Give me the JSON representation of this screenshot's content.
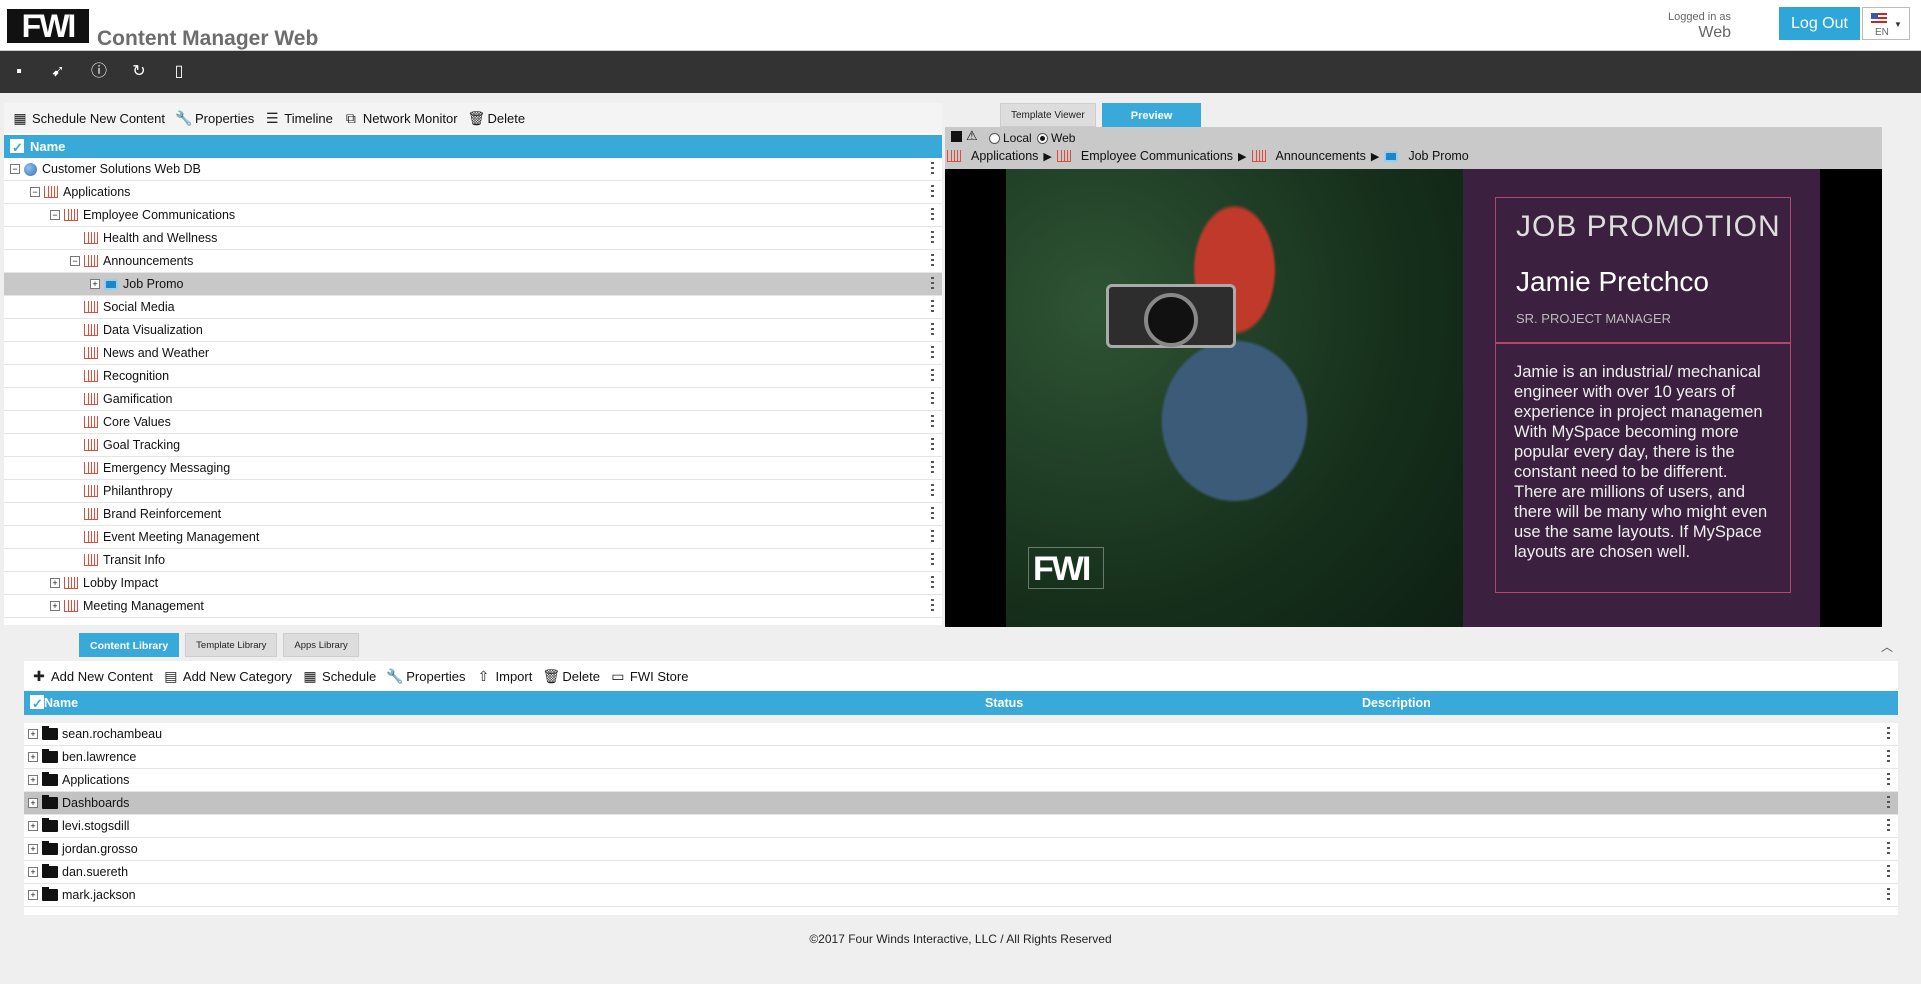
{
  "header": {
    "logo": "FWI",
    "title": "Content Manager Web",
    "logged_in_label": "Logged in as",
    "user": "Web",
    "logout_label": "Log Out",
    "language": "EN"
  },
  "toolbar_icons": [
    "save-icon",
    "rocket-icon",
    "info-icon",
    "refresh-icon",
    "device-icon"
  ],
  "tree_actions": [
    {
      "label": "Schedule New Content",
      "icon": "calendar-icon"
    },
    {
      "label": "Properties",
      "icon": "wrench-icon"
    },
    {
      "label": "Timeline",
      "icon": "timeline-icon"
    },
    {
      "label": "Network Monitor",
      "icon": "monitor-icon"
    },
    {
      "label": "Delete",
      "icon": "trash-icon"
    }
  ],
  "tree": {
    "header": "Name",
    "rows": [
      {
        "label": "Customer Solutions Web DB",
        "indent": 0,
        "expander": "−",
        "icon": "globe"
      },
      {
        "label": "Applications",
        "indent": 1,
        "expander": "−",
        "icon": "category"
      },
      {
        "label": "Employee Communications",
        "indent": 2,
        "expander": "−",
        "icon": "category"
      },
      {
        "label": "Health and Wellness",
        "indent": 3,
        "expander": "",
        "icon": "category"
      },
      {
        "label": "Announcements",
        "indent": 3,
        "expander": "−",
        "icon": "category"
      },
      {
        "label": "Job Promo",
        "indent": 4,
        "expander": "+",
        "icon": "screen",
        "selected": true
      },
      {
        "label": "Social Media",
        "indent": 3,
        "expander": "",
        "icon": "category"
      },
      {
        "label": "Data Visualization",
        "indent": 3,
        "expander": "",
        "icon": "category"
      },
      {
        "label": "News and Weather",
        "indent": 3,
        "expander": "",
        "icon": "category"
      },
      {
        "label": "Recognition",
        "indent": 3,
        "expander": "",
        "icon": "category"
      },
      {
        "label": "Gamification",
        "indent": 3,
        "expander": "",
        "icon": "category"
      },
      {
        "label": "Core Values",
        "indent": 3,
        "expander": "",
        "icon": "category"
      },
      {
        "label": "Goal Tracking",
        "indent": 3,
        "expander": "",
        "icon": "category"
      },
      {
        "label": "Emergency Messaging",
        "indent": 3,
        "expander": "",
        "icon": "category"
      },
      {
        "label": "Philanthropy",
        "indent": 3,
        "expander": "",
        "icon": "category"
      },
      {
        "label": "Brand Reinforcement",
        "indent": 3,
        "expander": "",
        "icon": "category"
      },
      {
        "label": "Event Meeting Management",
        "indent": 3,
        "expander": "",
        "icon": "category"
      },
      {
        "label": "Transit Info",
        "indent": 3,
        "expander": "",
        "icon": "category"
      },
      {
        "label": "Lobby Impact",
        "indent": 2,
        "expander": "+",
        "icon": "category"
      },
      {
        "label": "Meeting Management",
        "indent": 2,
        "expander": "+",
        "icon": "category"
      }
    ]
  },
  "preview": {
    "tabs": [
      "Template Viewer",
      "Preview"
    ],
    "active_tab": "Preview",
    "radio_local": "Local",
    "radio_web": "Web",
    "selected_source": "Web",
    "breadcrumb": [
      "Applications",
      "Employee Communications",
      "Announcements",
      "Job Promo"
    ],
    "watermark": "FWI",
    "card": {
      "heading": "JOB PROMOTION",
      "name": "Jamie Pretchco",
      "role": "SR. PROJECT MANAGER",
      "bio": "Jamie is an industrial/ mechanical engineer with over 10 years of experience in project managemen With MySpace becoming more popular every day, there is the constant need to be different. There are millions of users, and there will be many who might even use the same layouts. If MySpace layouts are chosen well."
    }
  },
  "library": {
    "tabs": [
      "Content Library",
      "Template Library",
      "Apps Library"
    ],
    "active_tab": "Content Library",
    "actions": [
      {
        "label": "Add New Content",
        "icon": "plus-icon"
      },
      {
        "label": "Add New Category",
        "icon": "add-category-icon"
      },
      {
        "label": "Schedule",
        "icon": "calendar-icon"
      },
      {
        "label": "Properties",
        "icon": "wrench-icon"
      },
      {
        "label": "Import",
        "icon": "import-icon"
      },
      {
        "label": "Delete",
        "icon": "trash-icon"
      },
      {
        "label": "FWI Store",
        "icon": "store-icon"
      }
    ],
    "columns": {
      "name": "Name",
      "status": "Status",
      "description": "Description"
    },
    "rows": [
      {
        "name": "sean.rochambeau"
      },
      {
        "name": "ben.lawrence"
      },
      {
        "name": "Applications"
      },
      {
        "name": "Dashboards",
        "selected": true
      },
      {
        "name": "levi.stogsdill"
      },
      {
        "name": "jordan.grosso"
      },
      {
        "name": "dan.suereth"
      },
      {
        "name": "mark.jackson"
      }
    ]
  },
  "footer": "©2017 Four Winds Interactive, LLC / All Rights Reserved",
  "colors": {
    "accent": "#39a9d9",
    "toolbar": "#333333",
    "card": "#3b213f",
    "card_border": "#b3466a"
  }
}
